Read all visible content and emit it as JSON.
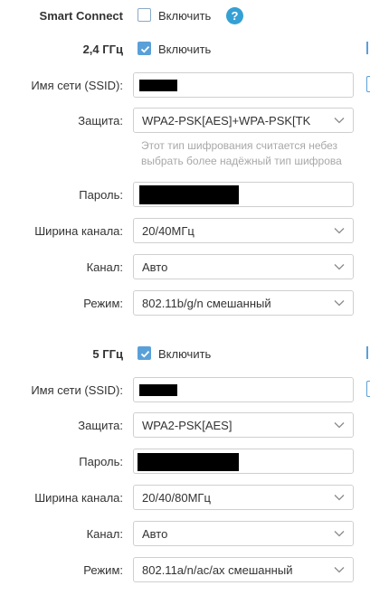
{
  "smart_connect": {
    "label": "Smart Connect",
    "checkbox_label": "Включить",
    "checked": false,
    "help_glyph": "?"
  },
  "band24": {
    "label": "2,4 ГГц",
    "enable_label": "Включить",
    "enabled": true,
    "ssid": {
      "label": "Имя сети (SSID):",
      "value": ""
    },
    "security": {
      "label": "Защита:",
      "value": "WPA2-PSK[AES]+WPA-PSK[TK"
    },
    "hint_lines": [
      "Этот тип шифрования считается небез",
      "выбрать более надёжный тип шифрова"
    ],
    "password": {
      "label": "Пароль:",
      "value": ""
    },
    "width": {
      "label": "Ширина канала:",
      "value": "20/40МГц"
    },
    "channel": {
      "label": "Канал:",
      "value": "Авто"
    },
    "mode": {
      "label": "Режим:",
      "value": "802.11b/g/n смешанный"
    }
  },
  "band5": {
    "label": "5 ГГц",
    "enable_label": "Включить",
    "enabled": true,
    "ssid": {
      "label": "Имя сети (SSID):",
      "value": ""
    },
    "security": {
      "label": "Защита:",
      "value": "WPA2-PSK[AES]"
    },
    "password": {
      "label": "Пароль:",
      "value": ""
    },
    "width": {
      "label": "Ширина канала:",
      "value": "20/40/80МГц"
    },
    "channel": {
      "label": "Канал:",
      "value": "Авто"
    },
    "mode": {
      "label": "Режим:",
      "value": "802.11a/n/ac/ax смешанный"
    }
  },
  "colors": {
    "accent": "#5aa0d8",
    "help": "#35a0d4",
    "hint": "#a8a8a8",
    "border": "#cfcfcf"
  }
}
